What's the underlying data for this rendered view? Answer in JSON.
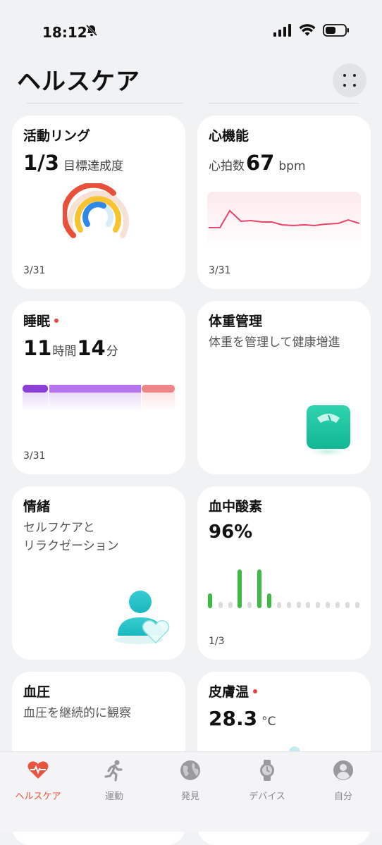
{
  "status": {
    "time": "18:12"
  },
  "header": {
    "title": "ヘルスケア"
  },
  "cards": {
    "activity": {
      "title": "活動リング",
      "value": "1/3",
      "label": "目標達成度",
      "date": "3/31"
    },
    "heart": {
      "title": "心機能",
      "label": "心拍数",
      "value": "67",
      "unit": "bpm",
      "date": "3/31"
    },
    "sleep": {
      "title": "睡眠",
      "hours": "11",
      "hours_unit": "時間",
      "minutes": "14",
      "minutes_unit": "分",
      "date": "3/31"
    },
    "weight": {
      "title": "体重管理",
      "subtitle": "体重を管理して健康増進"
    },
    "emotion": {
      "title": "情緒",
      "subtitle_line1": "セルフケアと",
      "subtitle_line2": "リラクゼーション"
    },
    "spo2": {
      "title": "血中酸素",
      "value": "96%",
      "date": "1/3"
    },
    "bp": {
      "title": "血圧",
      "subtitle": "血圧を継続的に観察"
    },
    "skin": {
      "title": "皮膚温",
      "value": "28.3",
      "unit": "°C"
    }
  },
  "nav": [
    {
      "label": "ヘルスケア",
      "icon": "heart-pulse-icon",
      "active": true
    },
    {
      "label": "運動",
      "icon": "runner-icon",
      "active": false
    },
    {
      "label": "発見",
      "icon": "globe-icon",
      "active": false
    },
    {
      "label": "デバイス",
      "icon": "watch-icon",
      "active": false
    },
    {
      "label": "自分",
      "icon": "person-icon",
      "active": false
    }
  ],
  "colors": {
    "accent": "#e8543d",
    "heart_line": "#e8436b",
    "spo2_bar": "#3dbb45",
    "sleep_deep": "#8a3fd6",
    "sleep_light": "#b774f0",
    "sleep_rem": "#f08585",
    "scale": "#22c9a4"
  }
}
